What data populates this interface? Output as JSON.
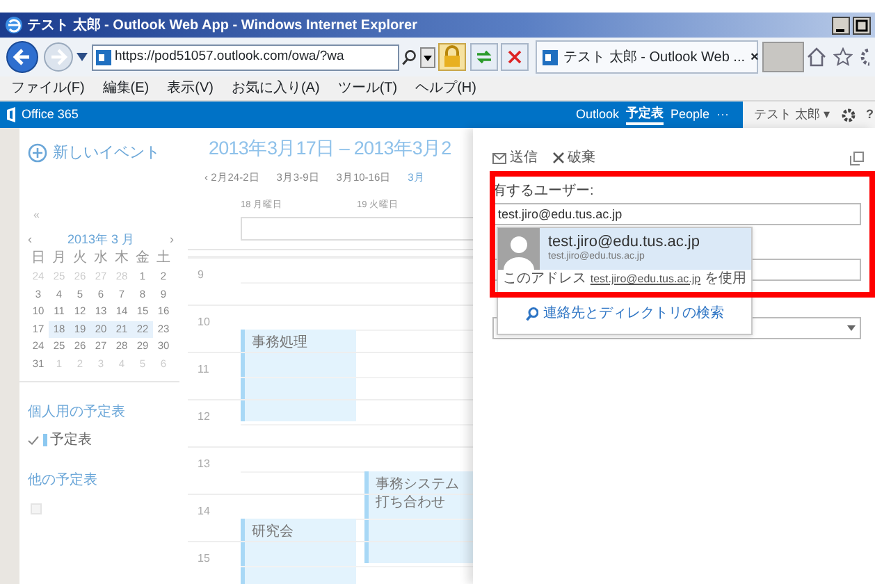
{
  "window": {
    "title": "テスト 太郎 - Outlook Web App - Windows Internet Explorer"
  },
  "browser": {
    "address": "https://pod51057.outlook.com/owa/?wa",
    "tab_title": "テスト 太郎 - Outlook Web ...",
    "tab_close": "×",
    "menu": [
      "ファイル(F)",
      "編集(E)",
      "表示(V)",
      "お気に入り(A)",
      "ツール(T)",
      "ヘルプ(H)"
    ]
  },
  "suite_bar": {
    "logo": "Office 365",
    "links": [
      {
        "label": "Outlook",
        "selected": false
      },
      {
        "label": "予定表",
        "selected": true
      },
      {
        "label": "People",
        "selected": false
      }
    ],
    "more": "···",
    "user": "テスト 太郎",
    "user_caret": "▾",
    "help": "?"
  },
  "sidebar": {
    "new_event": "新しいイベント",
    "collapse": "«",
    "mini_calendar": {
      "prev": "‹",
      "title": "2013年 3 月",
      "next": "›",
      "weekdays": [
        "日",
        "月",
        "火",
        "水",
        "木",
        "金",
        "土"
      ],
      "weeks": [
        [
          {
            "day": "24",
            "other_month": true,
            "selected": false
          },
          {
            "day": "25",
            "other_month": true,
            "selected": false
          },
          {
            "day": "26",
            "other_month": true,
            "selected": false
          },
          {
            "day": "27",
            "other_month": true,
            "selected": false
          },
          {
            "day": "28",
            "other_month": true,
            "selected": false
          },
          {
            "day": "1",
            "other_month": false,
            "selected": false
          },
          {
            "day": "2",
            "other_month": false,
            "selected": false
          }
        ],
        [
          {
            "day": "3",
            "other_month": false,
            "selected": false
          },
          {
            "day": "4",
            "other_month": false,
            "selected": false
          },
          {
            "day": "5",
            "other_month": false,
            "selected": false
          },
          {
            "day": "6",
            "other_month": false,
            "selected": false
          },
          {
            "day": "7",
            "other_month": false,
            "selected": false
          },
          {
            "day": "8",
            "other_month": false,
            "selected": false
          },
          {
            "day": "9",
            "other_month": false,
            "selected": false
          }
        ],
        [
          {
            "day": "10",
            "other_month": false,
            "selected": false
          },
          {
            "day": "11",
            "other_month": false,
            "selected": false
          },
          {
            "day": "12",
            "other_month": false,
            "selected": false
          },
          {
            "day": "13",
            "other_month": false,
            "selected": false
          },
          {
            "day": "14",
            "other_month": false,
            "selected": false
          },
          {
            "day": "15",
            "other_month": false,
            "selected": false
          },
          {
            "day": "16",
            "other_month": false,
            "selected": false
          }
        ],
        [
          {
            "day": "17",
            "other_month": false,
            "selected": false
          },
          {
            "day": "18",
            "other_month": false,
            "selected": true
          },
          {
            "day": "19",
            "other_month": false,
            "selected": true
          },
          {
            "day": "20",
            "other_month": false,
            "selected": true
          },
          {
            "day": "21",
            "other_month": false,
            "selected": true
          },
          {
            "day": "22",
            "other_month": false,
            "selected": true
          },
          {
            "day": "23",
            "other_month": false,
            "selected": false
          }
        ],
        [
          {
            "day": "24",
            "other_month": false,
            "selected": false
          },
          {
            "day": "25",
            "other_month": false,
            "selected": false
          },
          {
            "day": "26",
            "other_month": false,
            "selected": false
          },
          {
            "day": "27",
            "other_month": false,
            "selected": false
          },
          {
            "day": "28",
            "other_month": false,
            "selected": false
          },
          {
            "day": "29",
            "other_month": false,
            "selected": false
          },
          {
            "day": "30",
            "other_month": false,
            "selected": false
          }
        ],
        [
          {
            "day": "31",
            "other_month": false,
            "selected": false
          },
          {
            "day": "1",
            "other_month": true,
            "selected": false
          },
          {
            "day": "2",
            "other_month": true,
            "selected": false
          },
          {
            "day": "3",
            "other_month": true,
            "selected": false
          },
          {
            "day": "4",
            "other_month": true,
            "selected": false
          },
          {
            "day": "5",
            "other_month": true,
            "selected": false
          },
          {
            "day": "6",
            "other_month": true,
            "selected": false
          }
        ]
      ]
    },
    "sections": [
      {
        "title": "個人用の予定表",
        "items": [
          {
            "label": "予定表",
            "checked": true,
            "color": "#8cc8f0"
          }
        ]
      },
      {
        "title": "他の予定表",
        "items": [
          {
            "kind": "empty",
            "checked": false
          }
        ]
      }
    ]
  },
  "calendar": {
    "range_title": "2013年3月17日 – 2013年3月2",
    "week_nav": [
      {
        "label": "‹ 2月24-2日",
        "selected": false
      },
      {
        "label": "3月3-9日",
        "selected": false
      },
      {
        "label": "3月10-16日",
        "selected": false
      },
      {
        "label": "3月",
        "selected": true
      }
    ],
    "days": [
      "18 月曜日",
      "19 火曜日"
    ],
    "hours": [
      {
        "label": "9"
      },
      {
        "label": "10",
        "events": [
          {
            "title": "事務処理",
            "second_day": false,
            "half_past": true
          }
        ]
      },
      {
        "label": "11"
      },
      {
        "label": "12"
      },
      {
        "label": "13",
        "events": [
          {
            "title": "事務システム打ち合わせ",
            "second_day": true,
            "half_past": true
          }
        ]
      },
      {
        "label": "14",
        "events": [
          {
            "title": "研究会",
            "second_day": false,
            "half_past": true
          }
        ]
      },
      {
        "label": "15"
      }
    ]
  },
  "compose": {
    "toolbar": [
      {
        "label": "送信",
        "kind": "send"
      },
      {
        "label": "破棄",
        "kind": "discard"
      }
    ],
    "share_label": "有するユーザー:",
    "share_value": "test.jiro@edu.tus.ac.jp",
    "suggestion": {
      "name": "test.jiro@edu.tus.ac.jp",
      "email": "test.jiro@edu.tus.ac.jp",
      "selected": true
    },
    "use_address": {
      "before": "このアドレス ",
      "address": "test.jiro@edu.tus.ac.jp",
      "after": " を使用"
    },
    "search_directory": "連絡先とディレクトリの検索",
    "highlight": true
  }
}
